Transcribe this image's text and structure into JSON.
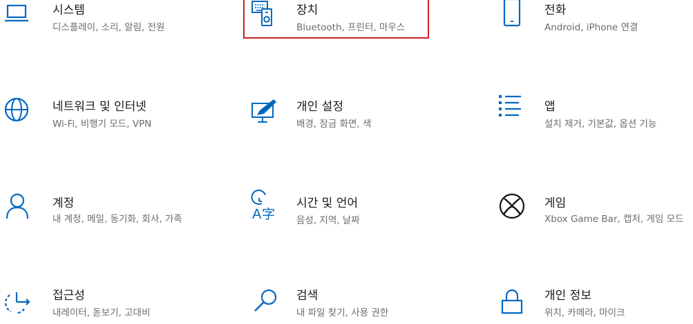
{
  "accent_color": "#0067c0",
  "highlight_color": "#cc1f24",
  "tiles": [
    {
      "icon": "laptop-icon",
      "title": "시스템",
      "desc": "디스플레이, 소리, 알림, 전원"
    },
    {
      "icon": "devices-icon",
      "title": "장치",
      "desc": "Bluetooth, 프린터, 마우스"
    },
    {
      "icon": "phone-icon",
      "title": "전화",
      "desc": "Android, iPhone 연결"
    },
    {
      "icon": "globe-icon",
      "title": "네트워크 및 인터넷",
      "desc": "Wi-Fi, 비행기 모드, VPN"
    },
    {
      "icon": "personalization-icon",
      "title": "개인 설정",
      "desc": "배경, 잠금 화면, 색"
    },
    {
      "icon": "apps-list-icon",
      "title": "앱",
      "desc": "설치 제거, 기본값, 옵션 기능"
    },
    {
      "icon": "person-icon",
      "title": "계정",
      "desc": "내 계정, 메일, 동기화, 회사, 가족"
    },
    {
      "icon": "time-language-icon",
      "title": "시간 및 언어",
      "desc": "음성, 지역, 날짜"
    },
    {
      "icon": "xbox-icon",
      "title": "게임",
      "desc": "Xbox Game Bar, 캡처, 게임 모드"
    },
    {
      "icon": "accessibility-icon",
      "title": "접근성",
      "desc": "내레이터, 돋보기, 고대비"
    },
    {
      "icon": "search-icon",
      "title": "검색",
      "desc": "내 파일 찾기, 사용 권한"
    },
    {
      "icon": "lock-icon",
      "title": "개인 정보",
      "desc": "위치, 카메라, 마이크"
    }
  ]
}
